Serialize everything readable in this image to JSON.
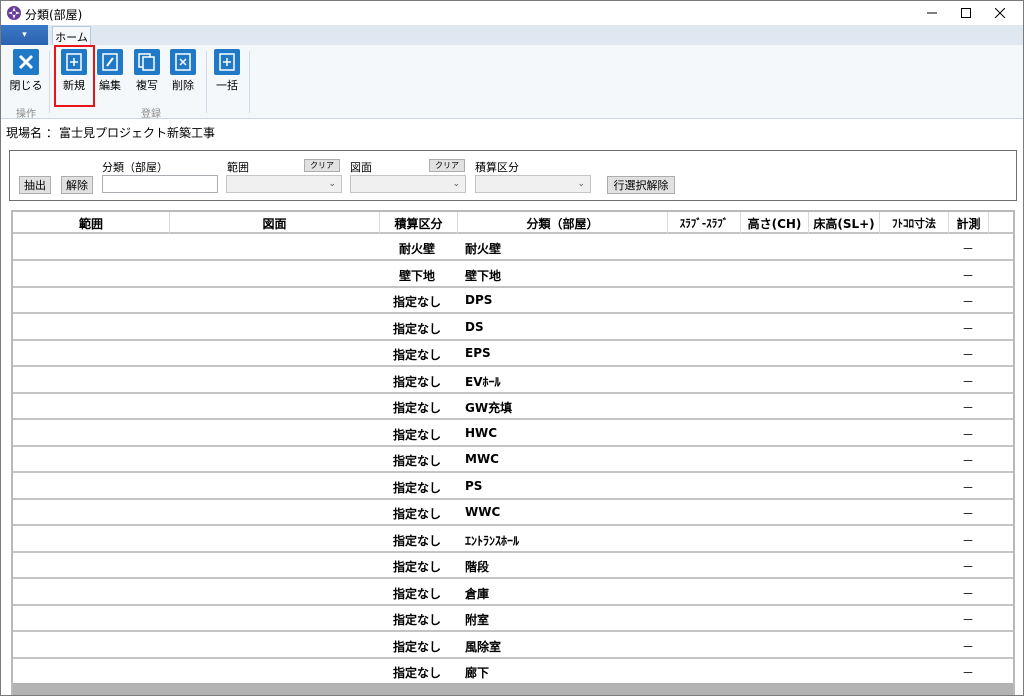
{
  "window": {
    "title": "分類(部屋)"
  },
  "ribbon": {
    "file_tab": "▾",
    "home_tab": "ホーム",
    "buttons": {
      "close": "閉じる",
      "new": "新規",
      "edit": "編集",
      "copy": "複写",
      "delete": "削除",
      "bulk": "一括"
    },
    "groups": {
      "operation": "操作",
      "register": "登録"
    }
  },
  "site": {
    "label": "現場名 ：",
    "value": "富士見プロジェクト新築工事"
  },
  "filter": {
    "extract": "抽出",
    "release": "解除",
    "class_label": "分類（部屋）",
    "range_label": "範囲",
    "drawing_label": "図面",
    "estimate_label": "積算区分",
    "clear1": "クリア",
    "clear2": "クリア",
    "row_release": "行選択解除"
  },
  "grid": {
    "columns": [
      "範囲",
      "図面",
      "積算区分",
      "分類（部屋）",
      "ｽﾗﾌﾞ-ｽﾗﾌﾞ",
      "高さ(CH)",
      "床高(SL+)",
      "ﾌﾄｺﾛ寸法",
      "計測"
    ],
    "rows": [
      {
        "kind": "耐火壁",
        "cls": "耐火壁",
        "meas": "－"
      },
      {
        "kind": "壁下地",
        "cls": "壁下地",
        "meas": "－"
      },
      {
        "kind": "指定なし",
        "cls": "DPS",
        "meas": "－"
      },
      {
        "kind": "指定なし",
        "cls": "DS",
        "meas": "－"
      },
      {
        "kind": "指定なし",
        "cls": "EPS",
        "meas": "－"
      },
      {
        "kind": "指定なし",
        "cls": "EVﾎｰﾙ",
        "meas": "－"
      },
      {
        "kind": "指定なし",
        "cls": "GW充填",
        "meas": "－"
      },
      {
        "kind": "指定なし",
        "cls": "HWC",
        "meas": "－"
      },
      {
        "kind": "指定なし",
        "cls": "MWC",
        "meas": "－"
      },
      {
        "kind": "指定なし",
        "cls": "PS",
        "meas": "－"
      },
      {
        "kind": "指定なし",
        "cls": "WWC",
        "meas": "－"
      },
      {
        "kind": "指定なし",
        "cls": "ｴﾝﾄﾗﾝｽﾎｰﾙ",
        "meas": "－"
      },
      {
        "kind": "指定なし",
        "cls": "階段",
        "meas": "－"
      },
      {
        "kind": "指定なし",
        "cls": "倉庫",
        "meas": "－"
      },
      {
        "kind": "指定なし",
        "cls": "附室",
        "meas": "－"
      },
      {
        "kind": "指定なし",
        "cls": "風除室",
        "meas": "－"
      },
      {
        "kind": "指定なし",
        "cls": "廊下",
        "meas": "－"
      }
    ]
  }
}
